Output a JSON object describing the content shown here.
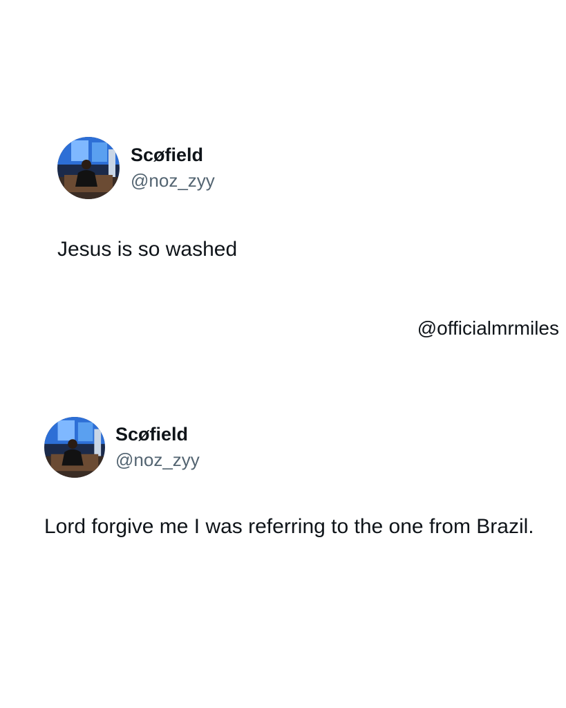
{
  "tweets": [
    {
      "avatar_icon": "profile-photo",
      "display_name": "Scøfield",
      "handle": "@noz_zyy",
      "text": "Jesus is so washed"
    },
    {
      "avatar_icon": "profile-photo",
      "display_name": "Scøfield",
      "handle": "@noz_zyy",
      "text": "Lord forgive me I was referring to the one from Brazil."
    }
  ],
  "watermark": "@officialmrmiles",
  "colors": {
    "text_primary": "#0f1419",
    "text_secondary": "#536471",
    "background": "#ffffff"
  }
}
